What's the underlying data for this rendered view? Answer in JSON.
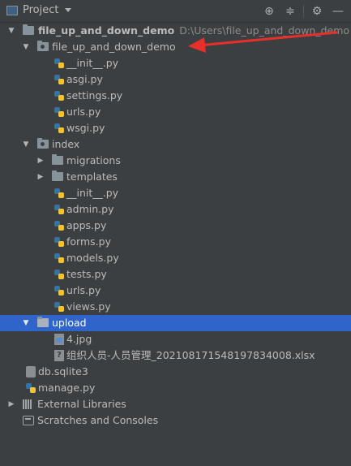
{
  "header": {
    "title": "Project",
    "icons": [
      "target-icon",
      "collapse-icon",
      "gear-icon",
      "minimize-icon"
    ]
  },
  "tree": {
    "root": {
      "label": "file_up_and_down_demo",
      "path": "D:\\Users\\file_up_and_down_demo"
    },
    "pkg": {
      "label": "file_up_and_down_demo"
    },
    "pkg_files": [
      "__init__.py",
      "asgi.py",
      "settings.py",
      "urls.py",
      "wsgi.py"
    ],
    "index": {
      "label": "index"
    },
    "index_folders": [
      "migrations",
      "templates"
    ],
    "index_files": [
      "__init__.py",
      "admin.py",
      "apps.py",
      "forms.py",
      "models.py",
      "tests.py",
      "urls.py",
      "views.py"
    ],
    "upload": {
      "label": "upload"
    },
    "upload_files": [
      "4.jpg",
      "组织人员-人员管理_20210817154819783400​8.xlsx"
    ],
    "root_files": [
      "db.sqlite3",
      "manage.py"
    ],
    "external": "External Libraries",
    "scratches": "Scratches and Consoles"
  },
  "colors": {
    "background": "#3c3f41",
    "selection": "#2f65ca",
    "annotation_arrow": "#e8302a"
  }
}
